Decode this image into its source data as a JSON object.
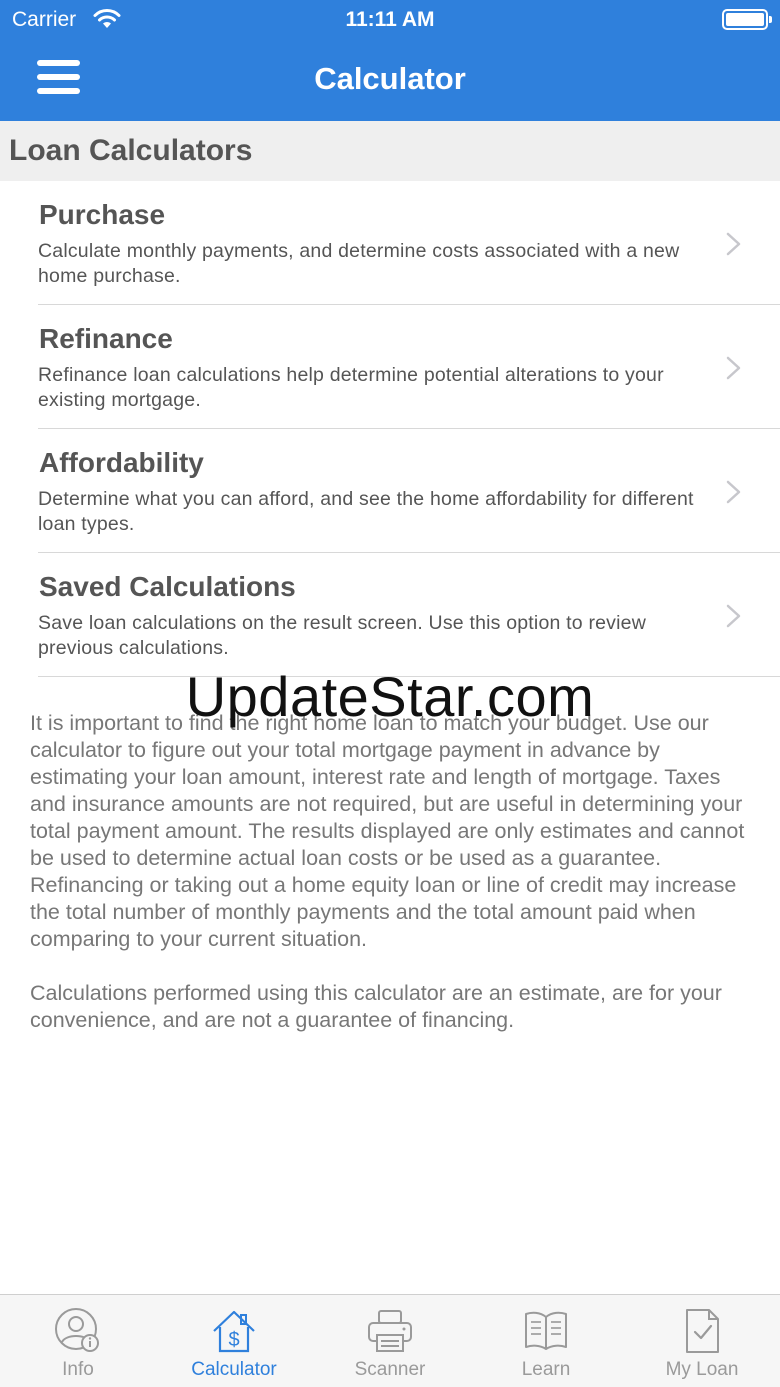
{
  "status_bar": {
    "carrier": "Carrier",
    "time": "11:11 AM"
  },
  "header": {
    "title": "Calculator",
    "menu_icon": "hamburger-menu-icon"
  },
  "section": {
    "title": "Loan Calculators"
  },
  "calculators": [
    {
      "title": "Purchase",
      "description": "Calculate monthly payments, and determine costs associated with a new home purchase."
    },
    {
      "title": "Refinance",
      "description": "Refinance loan calculations help determine potential alterations to your existing mortgage."
    },
    {
      "title": "Affordability",
      "description": "Determine what you can afford, and see the home affordability for different loan types."
    },
    {
      "title": "Saved Calculations",
      "description": "Save loan calculations on the result screen. Use this option to review previous calculations."
    }
  ],
  "watermark": "UpdateStar.com",
  "info": {
    "paragraph1": "It is important to find the right home loan to match your budget. Use our calculator to figure out your total mortgage payment in advance by estimating your loan amount, interest rate and length of mortgage. Taxes and insurance amounts are not required, but are useful in determining your total payment amount.  The results displayed are only estimates and cannot be used to determine actual loan costs or be used as a guarantee. Refinancing or taking out a home equity loan or line of credit may increase the total number of monthly payments and the total amount paid when comparing to your current situation.",
    "paragraph2": "Calculations performed using this calculator are an estimate, are for your convenience, and are not a guarantee of financing."
  },
  "tabs": [
    {
      "label": "Info",
      "icon": "user-info-icon",
      "active": false
    },
    {
      "label": "Calculator",
      "icon": "house-dollar-icon",
      "active": true
    },
    {
      "label": "Scanner",
      "icon": "printer-icon",
      "active": false
    },
    {
      "label": "Learn",
      "icon": "open-book-icon",
      "active": false
    },
    {
      "label": "My Loan",
      "icon": "document-check-icon",
      "active": false
    }
  ],
  "colors": {
    "brand_blue": "#2f80dc",
    "text_gray": "#555555",
    "inactive_tab": "#9a9a9a"
  }
}
